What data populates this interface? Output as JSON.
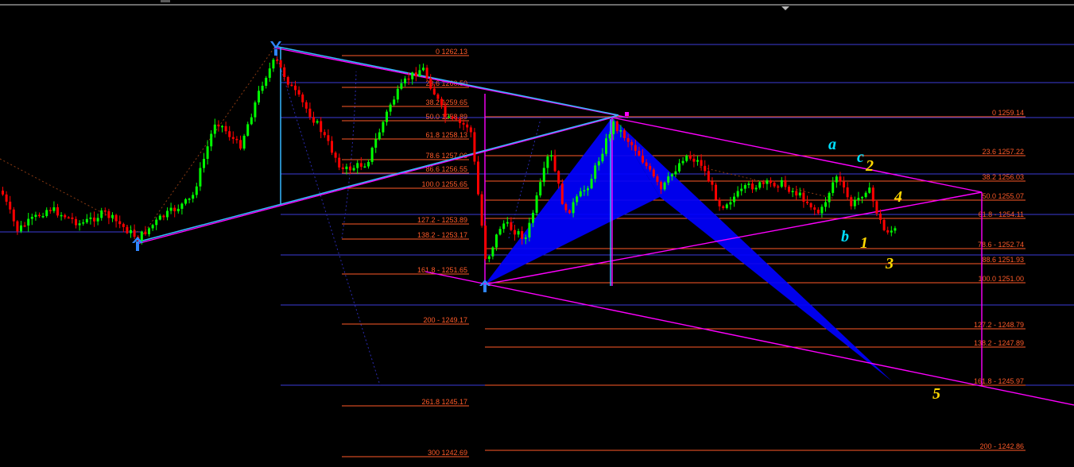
{
  "colors": {
    "background": "#000000",
    "bull": "#00ff00",
    "bear": "#ff0000",
    "fib": "#ff5a28",
    "pattern": "#0000ff",
    "channel": "#ff00ff",
    "trend": "#35b8ff",
    "guide": "#3b3bd8",
    "wave_yellow": "#ffd800",
    "wave_cyan": "#00e0ff"
  },
  "fib_set_left": [
    "0 1262.13",
    "23.6 1260.50",
    "38.2 1259.65",
    "50.0 1258.89",
    "61.8 1258.13",
    "78.6 1257.06",
    "86.6 1256.55",
    "100.0 1255.65",
    "127.2 - 1253.89",
    "138.2 - 1253.17",
    "161.8 - 1251.65",
    "200 - 1249.17",
    "261.8 1245.17",
    "300 1242.69"
  ],
  "fib_set_right": [
    "0 1259.14",
    "23.6 1257.22",
    "38.2 1256.03",
    "50.0 1255.07",
    "61.8 - 1254.11",
    "78.6 - 1252.74",
    "88.6 1251.93",
    "100.0 1251.00",
    "127.2 - 1248.79",
    "138.2 - 1247.89",
    "161.8 - 1245.97",
    "200 - 1242.86"
  ],
  "wave_labels": {
    "wave_1": "1",
    "wave_2": "2",
    "wave_3": "3",
    "wave_4": "4",
    "wave_5": "5",
    "wave_a": "a",
    "wave_b": "b",
    "wave_c": "c"
  },
  "icons": {
    "top_marker": "triangle-down-icon",
    "pivot_arrow": "arrow-pivot-icon"
  }
}
